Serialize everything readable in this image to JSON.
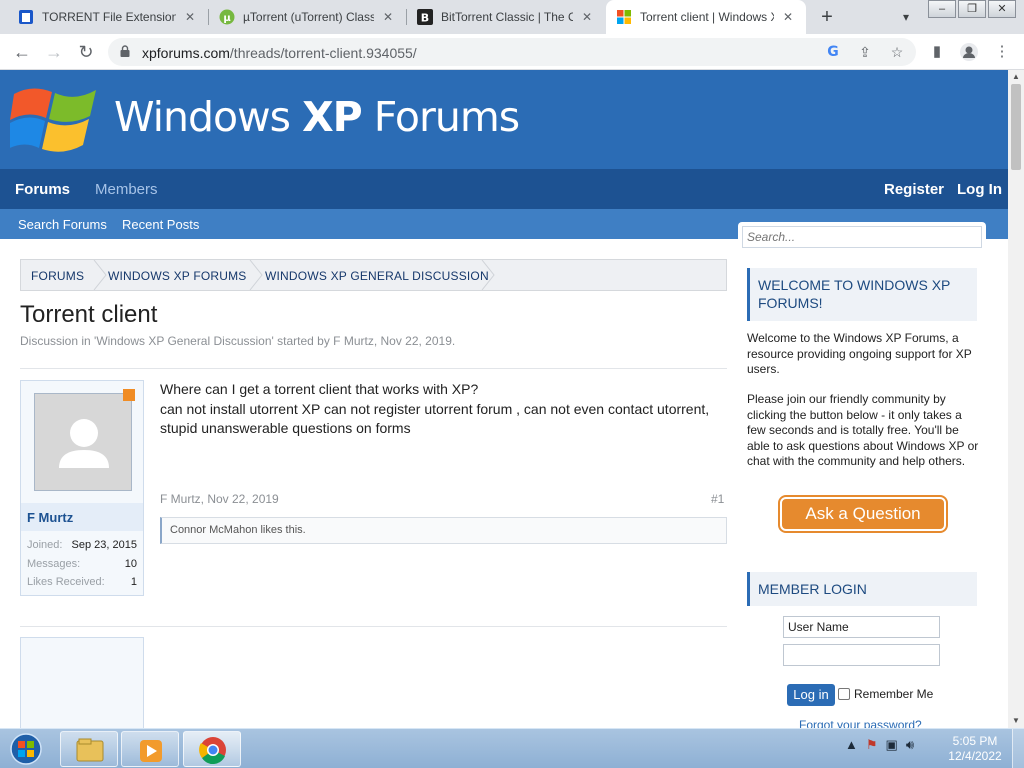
{
  "browser": {
    "tabs": [
      {
        "title": "TORRENT File Extension -",
        "icon": "file-icon",
        "active": false
      },
      {
        "title": "µTorrent (uTorrent) Classi",
        "icon": "utorrent-icon",
        "active": false
      },
      {
        "title": "BitTorrent Classic | The Of",
        "icon": "bittorrent-icon",
        "active": false
      },
      {
        "title": "Torrent client | Windows X",
        "icon": "windows-xp-icon",
        "active": true
      }
    ],
    "url_host": "xpforums.com",
    "url_path": "/threads/torrent-client.934055/",
    "accent": "#1a73e8"
  },
  "site": {
    "logo_prefix": "Windows ",
    "logo_bold": "XP",
    "logo_suffix": " Forums",
    "header_color": "#2b6cb5",
    "nav": {
      "forums": "Forums",
      "members": "Members",
      "register": "Register",
      "login": "Log In"
    },
    "subnav": {
      "search_forums": "Search Forums",
      "recent_posts": "Recent Posts"
    },
    "search_placeholder": "Search..."
  },
  "breadcrumb": [
    "FORUMS",
    "WINDOWS XP FORUMS",
    "WINDOWS XP GENERAL DISCUSSION"
  ],
  "thread": {
    "title": "Torrent client",
    "meta": "Discussion in 'Windows XP General Discussion' started by F Murtz, Nov 22, 2019."
  },
  "post": {
    "author": "F Murtz",
    "stats": [
      {
        "label": "Joined:",
        "value": "Sep 23, 2015"
      },
      {
        "label": "Messages:",
        "value": "10"
      },
      {
        "label": "Likes Received:",
        "value": "1"
      }
    ],
    "line1": "Where can I get a torrent client that works with XP?",
    "line2": "can not install utorrent XP can not register utorrent forum , can not even contact utorrent, stupid unanswerable questions on forms",
    "footer_left": "F Murtz, Nov 22, 2019",
    "footer_right": "#1",
    "likes": "Connor McMahon likes this."
  },
  "sidebar": {
    "welcome_title": "WELCOME TO WINDOWS XP FORUMS!",
    "welcome_p1": "Welcome to the Windows XP Forums, a resource providing ongoing support for XP users.",
    "welcome_p2": "Please join our friendly community by clicking the button below - it only takes a few seconds and is totally free. You'll be able to ask questions about Windows XP or chat with the community and help others.",
    "ask_button": "Ask a Question",
    "ask_color": "#e68a2e",
    "login_title": "MEMBER LOGIN",
    "username_value": "User Name",
    "password_value": "",
    "login_button": "Log in",
    "remember_label": "Remember Me",
    "forgot_link": "Forgot your password?"
  },
  "taskbar": {
    "time": "5:05 PM",
    "date": "12/4/2022",
    "apps": [
      "explorer-icon",
      "media-player-icon",
      "chrome-icon"
    ]
  }
}
